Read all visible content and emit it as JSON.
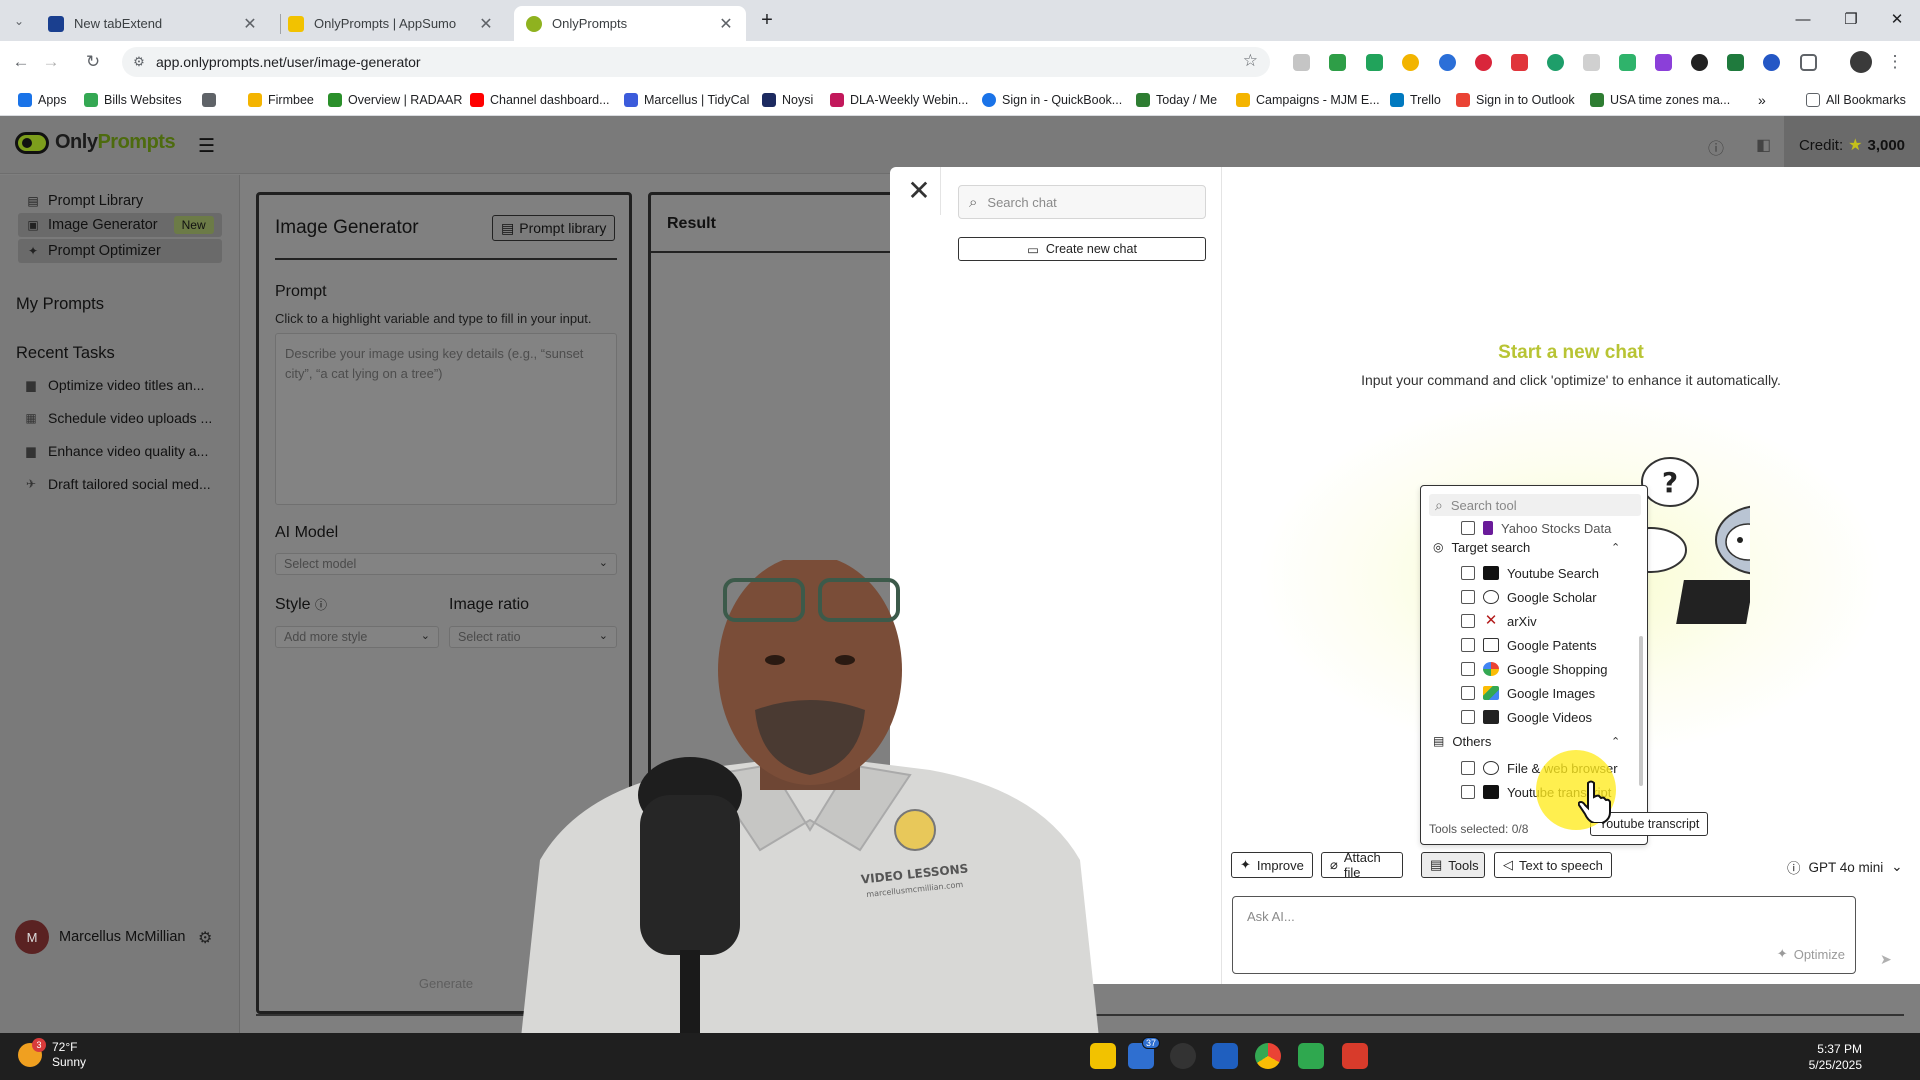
{
  "browser": {
    "tabs": [
      {
        "title": "New tabExtend",
        "active": false
      },
      {
        "title": "OnlyPrompts | AppSumo",
        "active": false
      },
      {
        "title": "OnlyPrompts",
        "active": true
      }
    ],
    "new_tab_glyph": "+",
    "url": "app.onlyprompts.net/user/image-generator",
    "bookmarks": [
      "Apps",
      "Bills Websites",
      "Firmbee",
      "Overview | RADAAR",
      "Channel dashboard...",
      "Marcellus | TidyCal",
      "Noysi",
      "DLA-Weekly Webin...",
      "Sign in - QuickBook...",
      "Today / Me",
      "Campaigns - MJM E...",
      "Trello",
      "Sign in to Outlook",
      "USA time zones ma..."
    ],
    "all_bookmarks": "All Bookmarks"
  },
  "app": {
    "logo_only": "Only",
    "logo_prompts": "Prompts",
    "credit_label": "Credit:",
    "credit_value": "3,000",
    "sidebar": {
      "items": [
        {
          "label": "Prompt Library",
          "icon": "doc-icon"
        },
        {
          "label": "Image Generator",
          "icon": "image-icon",
          "badge": "New"
        },
        {
          "label": "Prompt Optimizer",
          "icon": "sparkle-icon"
        }
      ],
      "my_prompts": "My Prompts",
      "recent_tasks_heading": "Recent Tasks",
      "recent_tasks": [
        "Optimize video titles an...",
        "Schedule video uploads ...",
        "Enhance video quality a...",
        "Draft tailored social med..."
      ],
      "user_initial": "M",
      "user_name": "Marcellus McMillian"
    },
    "image_generator": {
      "title": "Image Generator",
      "library_button": "Prompt library",
      "prompt_label": "Prompt",
      "prompt_hint": "Click to a highlight variable and type to fill in your input.",
      "prompt_placeholder": "Describe your image using key details (e.g., “sunset city”, “a cat lying on a tree”)",
      "ai_model_label": "AI Model",
      "ai_model_placeholder": "Select model",
      "style_label": "Style",
      "style_placeholder": "Add more style",
      "ratio_label": "Image ratio",
      "ratio_placeholder": "Select ratio",
      "generate_label": "Generate"
    },
    "result": {
      "title": "Result"
    }
  },
  "chat_modal": {
    "search_placeholder": "Search chat",
    "new_chat_label": "Create new chat",
    "start_title": "Start a new chat",
    "start_subtitle": "Input your command and click 'optimize' to enhance it automatically.",
    "tools_popup": {
      "search_placeholder": "Search tool",
      "partial_item": "Yahoo Stocks Data",
      "sections": [
        {
          "title": "Target search",
          "items": [
            "Youtube Search",
            "Google Scholar",
            "arXiv",
            "Google Patents",
            "Google Shopping",
            "Google Images",
            "Google Videos"
          ]
        },
        {
          "title": "Others",
          "items": [
            "File & web browser",
            "Youtube transcript"
          ]
        }
      ],
      "selected_count": "Tools selected: 0/8"
    },
    "tooltip": "Youtube transcript",
    "buttons": {
      "improve": "Improve",
      "attach": "Attach file",
      "tools": "Tools",
      "tts": "Text to speech"
    },
    "model": "GPT 4o mini",
    "ask_placeholder": "Ask AI...",
    "optimize_label": "Optimize"
  },
  "webcam": {
    "shirt_text_1": "VIDEO LESSONS",
    "shirt_text_2": "marcellusmcmillian.com"
  },
  "taskbar": {
    "weather_badge": "3",
    "temperature": "72°F",
    "condition": "Sunny",
    "badge_count": "37",
    "time": "5:37 PM",
    "date": "5/25/2025"
  },
  "colors": {
    "accent": "#b8c434",
    "brand": "#7d9e1c",
    "overlay_grey": "#7f7f7f",
    "highlight": "#ffeb1e"
  }
}
